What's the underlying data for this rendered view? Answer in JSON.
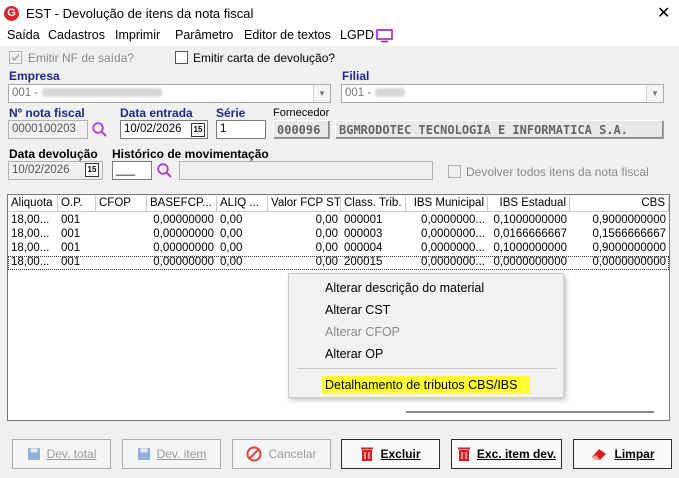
{
  "window": {
    "title": "EST - Devolução de itens da nota fiscal",
    "app_icon": "G"
  },
  "menu": [
    "Saída",
    "Cadastros",
    "Imprimir",
    "Parâmetro",
    "Editor de textos",
    "LGPD"
  ],
  "options": {
    "emitir_nf": "Emitir NF de saída?",
    "emitir_carta": "Emitir carta de devolução?"
  },
  "empresa": {
    "label": "Empresa",
    "value": "001 -"
  },
  "filial": {
    "label": "Filial",
    "value": "001 -"
  },
  "nota": {
    "label": "Nº nota fiscal",
    "value": "0000100203"
  },
  "data_entrada": {
    "label": "Data entrada",
    "value": "10/02/2026"
  },
  "serie": {
    "label": "Série",
    "value": "1"
  },
  "fornecedor": {
    "label": "Fornecedor",
    "code": "000096",
    "name": "BGMRODOTEC TECNOLOGIA E INFORMATICA S.A."
  },
  "data_devolucao": {
    "label": "Data devolução",
    "value": "10/02/2026"
  },
  "historico": {
    "label": "Histórico de movimentação",
    "value": "___"
  },
  "devolver_todos": "Devolver todos itens da nota fiscal",
  "grid": {
    "columns": [
      "Aliquota",
      "O.P.",
      "CFOP",
      "BASEFCP...",
      "ALIQ ...",
      "Valor FCP ST",
      "Class. Trib.",
      "IBS Municipal",
      "IBS Estadual",
      "CBS"
    ],
    "rows": [
      [
        "18,00...",
        "001",
        "",
        "0,00000000",
        "0,00",
        "0,00",
        "000001",
        "0,0000000...",
        "0,1000000000",
        "0,9000000000"
      ],
      [
        "18,00...",
        "001",
        "",
        "0,00000000",
        "0,00",
        "0,00",
        "000003",
        "0,0000000...",
        "0,0166666667",
        "0,1566666667"
      ],
      [
        "18,00...",
        "001",
        "",
        "0,00000000",
        "0,00",
        "0,00",
        "000004",
        "0,0000000...",
        "0,1000000000",
        "0,9000000000"
      ],
      [
        "18,00...",
        "001",
        "",
        "0,00000000",
        "0,00",
        "0,00",
        "200015",
        "0,0000000...",
        "0,0000000000",
        "0,0000000000"
      ]
    ]
  },
  "context_menu": {
    "items": [
      "Alterar descrição do material",
      "Alterar CST",
      "Alterar CFOP",
      "Alterar OP",
      "Detalhamento de tributos CBS/IBS"
    ],
    "highlight_color": "#ffff33"
  },
  "buttons": {
    "dev_total": "Dev. total",
    "dev_item": "Dev. item",
    "cancelar": "Cancelar",
    "excluir": "Excluir",
    "exc_item": "Exc. item dev.",
    "limpar": "Limpar"
  }
}
